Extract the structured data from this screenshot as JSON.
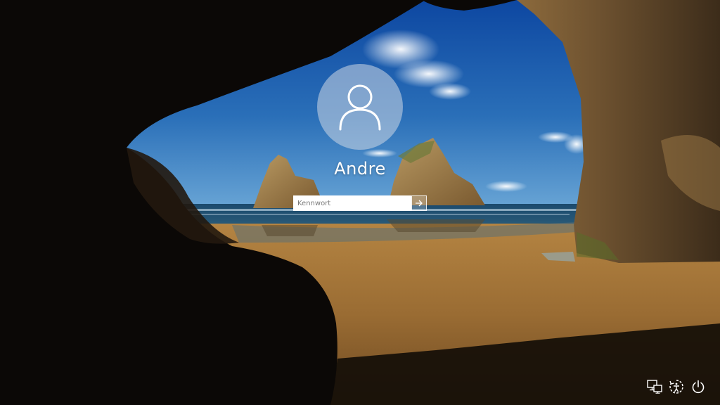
{
  "user": {
    "name": "Andre"
  },
  "password": {
    "placeholder": "Kennwort",
    "value": ""
  },
  "icons": {
    "avatar": "user-silhouette-icon",
    "submit": "arrow-right-icon",
    "network": "network-icon",
    "ease_of_access": "ease-of-access-icon",
    "power": "power-icon"
  },
  "colors": {
    "sky": "#1f5fa8",
    "sand": "#a87a3e",
    "cave": "#0d0a07",
    "text": "#ffffff"
  }
}
